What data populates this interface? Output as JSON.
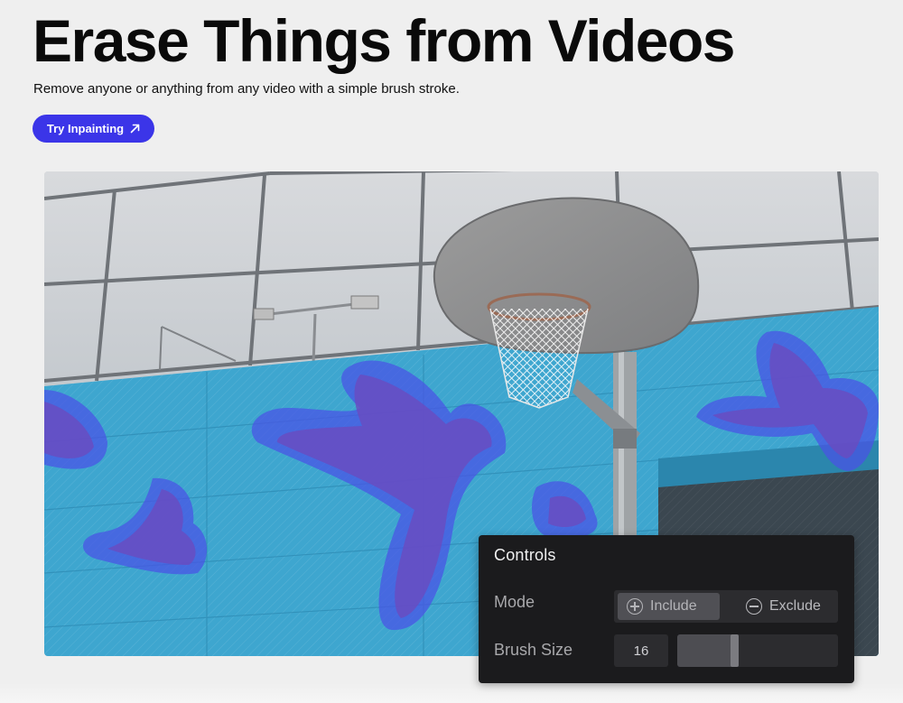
{
  "hero": {
    "title": "Erase Things from Videos",
    "subtitle": "Remove anyone or anything from any video with a simple brush stroke.",
    "cta_label": "Try Inpainting",
    "cta_color": "#3b35e8"
  },
  "video": {
    "mask_color": "#4a52e6",
    "wall_color": "#3ea6cf"
  },
  "controls": {
    "title": "Controls",
    "mode_label": "Mode",
    "mode_options": [
      {
        "label": "Include",
        "icon": "plus-circle-icon",
        "selected": true
      },
      {
        "label": "Exclude",
        "icon": "minus-circle-icon",
        "selected": false
      }
    ],
    "brush_size_label": "Brush Size",
    "brush_size_value": "16",
    "brush_size_fraction": 0.37
  }
}
